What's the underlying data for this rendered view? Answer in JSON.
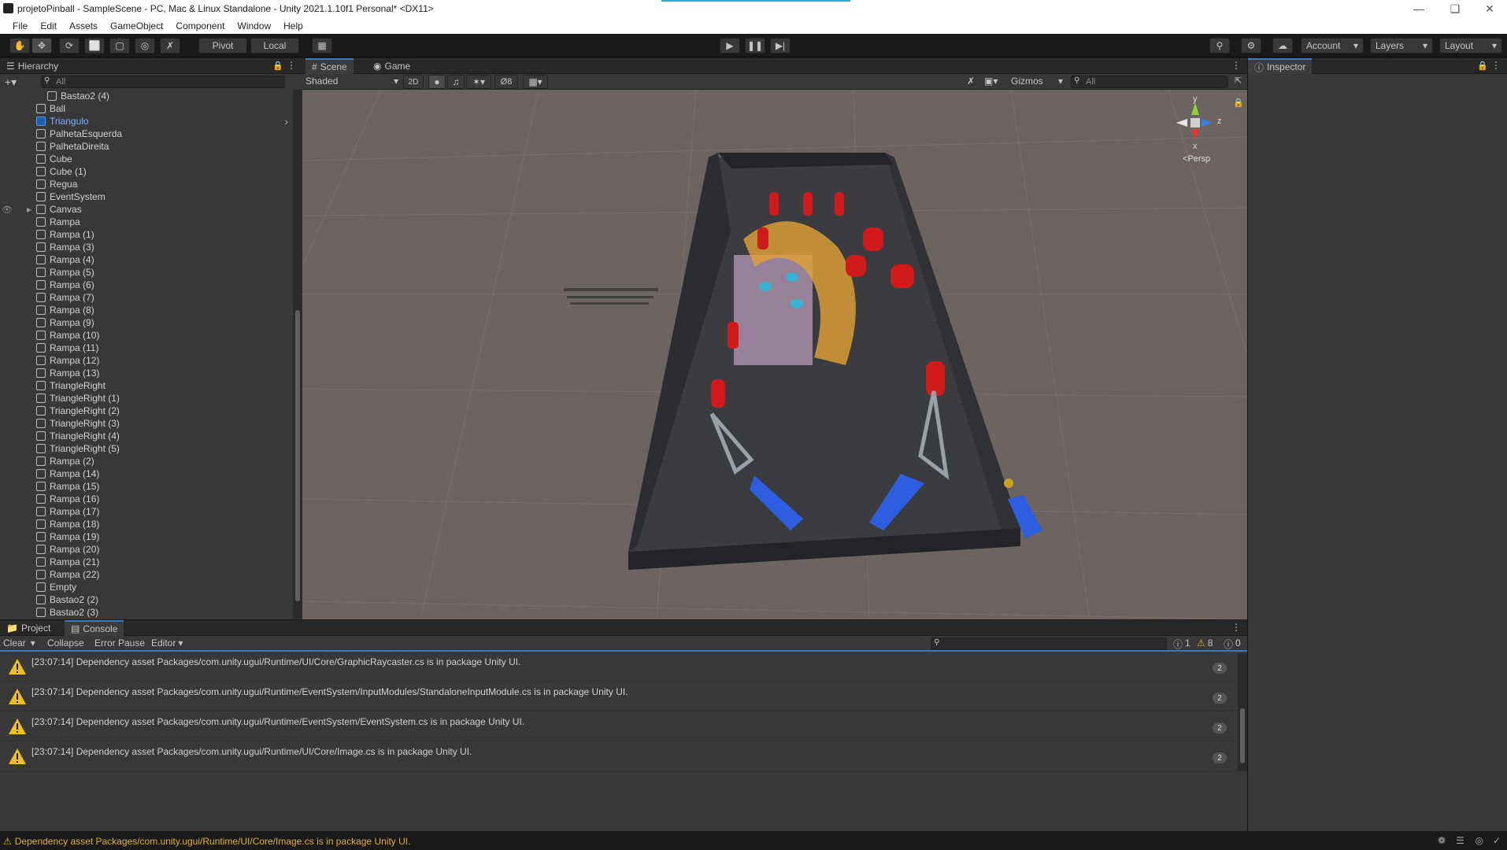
{
  "window": {
    "title": "projetoPinball - SampleScene - PC, Mac & Linux Standalone - Unity 2021.1.10f1 Personal* <DX11>"
  },
  "menu": [
    "File",
    "Edit",
    "Assets",
    "GameObject",
    "Component",
    "Window",
    "Help"
  ],
  "toolbar": {
    "pivot_label": "Pivot",
    "local_label": "Local",
    "account_label": "Account",
    "layers_label": "Layers",
    "layout_label": "Layout"
  },
  "hierarchy": {
    "tab_label": "Hierarchy",
    "search_placeholder": "All",
    "items": [
      {
        "label": "Bastao2 (4)",
        "indent": 2
      },
      {
        "label": "Ball",
        "indent": 1
      },
      {
        "label": "Triangulo",
        "indent": 1,
        "selected": true
      },
      {
        "label": "PalhetaEsquerda",
        "indent": 1
      },
      {
        "label": "PalhetaDireita",
        "indent": 1
      },
      {
        "label": "Cube",
        "indent": 1
      },
      {
        "label": "Cube (1)",
        "indent": 1
      },
      {
        "label": "Regua",
        "indent": 1
      },
      {
        "label": "EventSystem",
        "indent": 1
      },
      {
        "label": "Canvas",
        "indent": 1,
        "expandable": true
      },
      {
        "label": "Rampa",
        "indent": 1
      },
      {
        "label": "Rampa (1)",
        "indent": 1
      },
      {
        "label": "Rampa (3)",
        "indent": 1
      },
      {
        "label": "Rampa (4)",
        "indent": 1
      },
      {
        "label": "Rampa (5)",
        "indent": 1
      },
      {
        "label": "Rampa (6)",
        "indent": 1
      },
      {
        "label": "Rampa (7)",
        "indent": 1
      },
      {
        "label": "Rampa (8)",
        "indent": 1
      },
      {
        "label": "Rampa (9)",
        "indent": 1
      },
      {
        "label": "Rampa (10)",
        "indent": 1
      },
      {
        "label": "Rampa (11)",
        "indent": 1
      },
      {
        "label": "Rampa (12)",
        "indent": 1
      },
      {
        "label": "Rampa (13)",
        "indent": 1
      },
      {
        "label": "TriangleRight",
        "indent": 1
      },
      {
        "label": "TriangleRight (1)",
        "indent": 1
      },
      {
        "label": "TriangleRight (2)",
        "indent": 1
      },
      {
        "label": "TriangleRight (3)",
        "indent": 1
      },
      {
        "label": "TriangleRight (4)",
        "indent": 1
      },
      {
        "label": "TriangleRight (5)",
        "indent": 1
      },
      {
        "label": "Rampa (2)",
        "indent": 1
      },
      {
        "label": "Rampa (14)",
        "indent": 1
      },
      {
        "label": "Rampa (15)",
        "indent": 1
      },
      {
        "label": "Rampa (16)",
        "indent": 1
      },
      {
        "label": "Rampa (17)",
        "indent": 1
      },
      {
        "label": "Rampa (18)",
        "indent": 1
      },
      {
        "label": "Rampa (19)",
        "indent": 1
      },
      {
        "label": "Rampa (20)",
        "indent": 1
      },
      {
        "label": "Rampa (21)",
        "indent": 1
      },
      {
        "label": "Rampa (22)",
        "indent": 1
      },
      {
        "label": "Empty",
        "indent": 1
      },
      {
        "label": "Bastao2 (2)",
        "indent": 1
      },
      {
        "label": "Bastao2 (3)",
        "indent": 1
      }
    ]
  },
  "scene": {
    "tab_scene": "Scene",
    "tab_game": "Game",
    "shading": "Shaded",
    "mode_2d": "2D",
    "hidden_count": "8",
    "gizmos_label": "Gizmos",
    "search_placeholder": "All",
    "gizmo_axes": {
      "y": "y",
      "z": "z",
      "x": "x"
    },
    "persp_label": "Persp"
  },
  "inspector": {
    "tab_label": "Inspector"
  },
  "bottom": {
    "tab_project": "Project",
    "tab_console": "Console",
    "clear_label": "Clear",
    "collapse_label": "Collapse",
    "error_pause_label": "Error Pause",
    "editor_label": "Editor",
    "count_info": "1",
    "count_warn": "8",
    "count_error": "0",
    "messages": [
      {
        "text": "[23:07:14] Dependency asset Packages/com.unity.ugui/Runtime/UI/Core/GraphicRaycaster.cs is in package Unity UI.",
        "count": "2"
      },
      {
        "text": "[23:07:14] Dependency asset Packages/com.unity.ugui/Runtime/EventSystem/InputModules/StandaloneInputModule.cs is in package Unity UI.",
        "count": "2"
      },
      {
        "text": "[23:07:14] Dependency asset Packages/com.unity.ugui/Runtime/EventSystem/EventSystem.cs is in package Unity UI.",
        "count": "2"
      },
      {
        "text": "[23:07:14] Dependency asset Packages/com.unity.ugui/Runtime/UI/Core/Image.cs is in package Unity UI.",
        "count": "2"
      }
    ]
  },
  "status": {
    "text": "Dependency asset Packages/com.unity.ugui/Runtime/UI/Core/Image.cs is in package Unity UI."
  },
  "colors": {
    "accent": "#3a79bb",
    "selected_text": "#7cb0ff",
    "warning": "#e0b030"
  }
}
